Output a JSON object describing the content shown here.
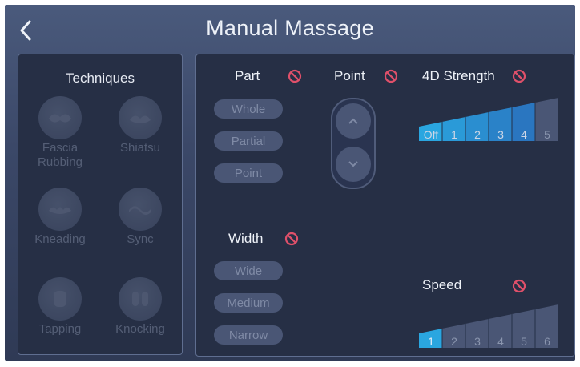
{
  "header": {
    "title": "Manual Massage"
  },
  "techniques": {
    "title": "Techniques",
    "items": [
      {
        "label": "Fascia\nRubbing",
        "icon": "fascia-rubbing-icon"
      },
      {
        "label": "Shiatsu",
        "icon": "shiatsu-icon"
      },
      {
        "label": "Kneading",
        "icon": "kneading-icon"
      },
      {
        "label": "Sync",
        "icon": "sync-icon"
      },
      {
        "label": "Tapping",
        "icon": "tapping-icon"
      },
      {
        "label": "Knocking",
        "icon": "knocking-icon"
      }
    ]
  },
  "part": {
    "label": "Part",
    "options": [
      "Whole",
      "Partial",
      "Point"
    ]
  },
  "point": {
    "label": "Point"
  },
  "width": {
    "label": "Width",
    "options": [
      "Wide",
      "Medium",
      "Narrow"
    ]
  },
  "strength": {
    "label": "4D Strength",
    "levels": [
      "Off",
      "1",
      "2",
      "3",
      "4",
      "5"
    ],
    "selected_index": 5
  },
  "speed": {
    "label": "Speed",
    "levels": [
      "1",
      "2",
      "3",
      "4",
      "5",
      "6"
    ],
    "selected_index": 0
  },
  "colors": {
    "disabled_icon": "#e0506a",
    "level_active": "#2aa6e0",
    "level_inactive": "#4a5675"
  }
}
